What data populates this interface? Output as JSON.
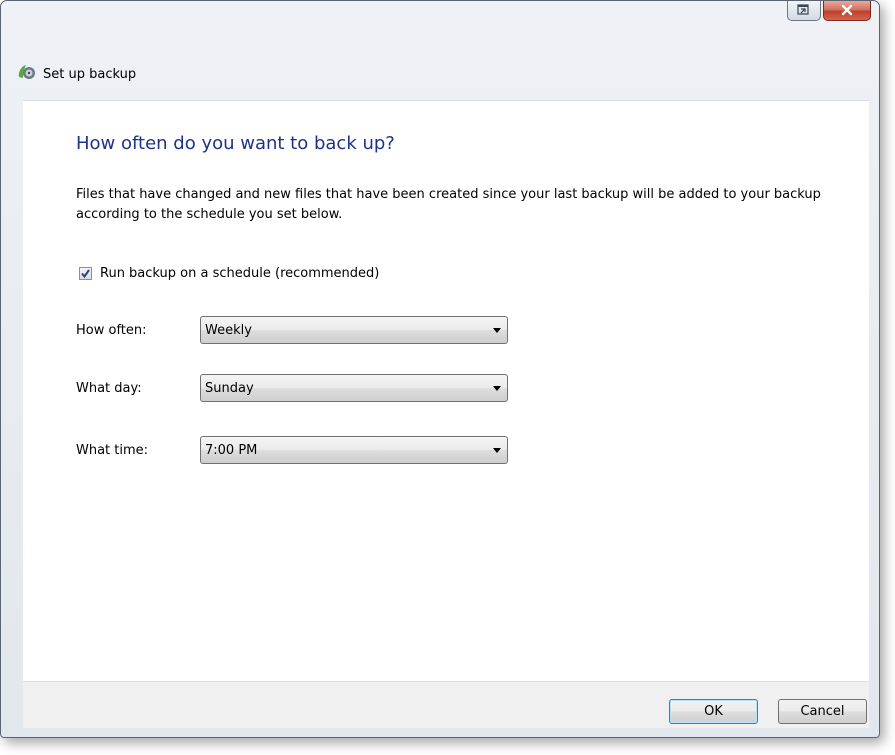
{
  "window": {
    "title": "Set up backup",
    "icons": {
      "app": "backup-icon",
      "restore": "restore-window-icon",
      "close": "close-icon"
    }
  },
  "page": {
    "heading": "How often do you want to back up?",
    "description": "Files that have changed and new files that have been created since your last backup will be added to your backup according to the schedule you set below."
  },
  "schedule": {
    "checkbox_label": "Run backup on a schedule (recommended)",
    "checked": true,
    "how_often": {
      "label": "How often:",
      "value": "Weekly"
    },
    "what_day": {
      "label": "What day:",
      "value": "Sunday"
    },
    "what_time": {
      "label": "What time:",
      "value": "7:00 PM"
    }
  },
  "buttons": {
    "ok": "OK",
    "cancel": "Cancel"
  },
  "colors": {
    "heading": "#1e3287",
    "close_button": "#c0402b",
    "footer": "#f0f0f0"
  }
}
